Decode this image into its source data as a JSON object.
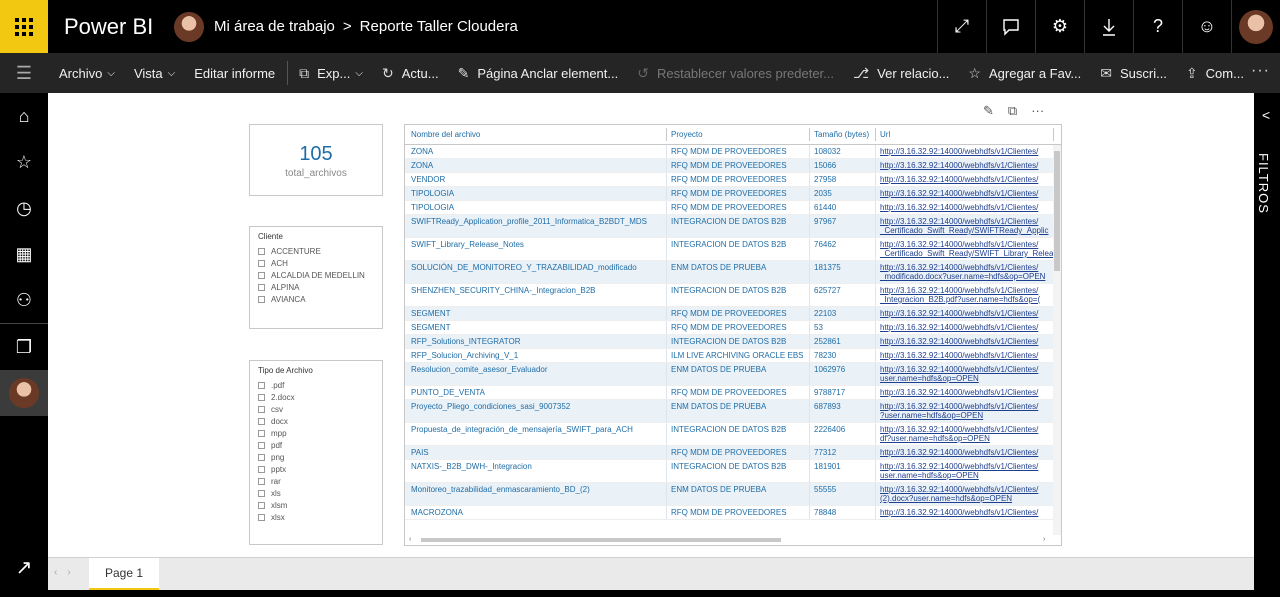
{
  "app": {
    "brand": "Power BI"
  },
  "breadcrumb": {
    "workspace": "Mi área de trabajo",
    "separator": ">",
    "report": "Reporte Taller Cloudera"
  },
  "top_icons": [
    "expand-icon",
    "comment-icon",
    "settings-icon",
    "download-icon",
    "help-icon",
    "smiley-icon"
  ],
  "toolbar": {
    "archivo": "Archivo",
    "vista": "Vista",
    "editar": "Editar informe",
    "exportar": "Exp...",
    "actualizar": "Actu...",
    "anclar": "Página Anclar element...",
    "restablecer": "Restablecer valores predeter...",
    "relaciones": "Ver relacio...",
    "favoritos": "Agregar a Fav...",
    "suscribir": "Suscri...",
    "compartir": "Com...",
    "more": "···"
  },
  "filter_pane": {
    "label": "FILTROS"
  },
  "card": {
    "value": "105",
    "label": "total_archivos"
  },
  "slicer_cliente": {
    "title": "Cliente",
    "items": [
      "ACCENTURE",
      "ACH",
      "ALCALDIA DE MEDELLIN",
      "ALPINA",
      "AVIANCA"
    ]
  },
  "slicer_tipo": {
    "title": "Tipo de Archivo",
    "items": [
      ".pdf",
      "2.docx",
      "csv",
      "docx",
      "mpp",
      "pdf",
      "png",
      "pptx",
      "rar",
      "xls",
      "xlsm",
      "xlsx"
    ]
  },
  "table": {
    "headers": [
      "Nombre del archivo",
      "Proyecto",
      "Tamaño (bytes)",
      "Url"
    ],
    "rows": [
      {
        "name": "ZONA",
        "project": "RFQ MDM DE PROVEEDORES",
        "size": "108032",
        "url1": "http://3.16.32.92:14000/webhdfs/v1/Clientes/",
        "url2": ""
      },
      {
        "name": "ZONA",
        "project": "RFQ MDM DE PROVEEDORES",
        "size": "15066",
        "url1": "http://3.16.32.92:14000/webhdfs/v1/Clientes/",
        "url2": ""
      },
      {
        "name": "VENDOR",
        "project": "RFQ MDM DE PROVEEDORES",
        "size": "27958",
        "url1": "http://3.16.32.92:14000/webhdfs/v1/Clientes/",
        "url2": ""
      },
      {
        "name": "TIPOLOGIA",
        "project": "RFQ MDM DE PROVEEDORES",
        "size": "2035",
        "url1": "http://3.16.32.92:14000/webhdfs/v1/Clientes/",
        "url2": ""
      },
      {
        "name": "TIPOLOGIA",
        "project": "RFQ MDM DE PROVEEDORES",
        "size": "61440",
        "url1": "http://3.16.32.92:14000/webhdfs/v1/Clientes/",
        "url2": ""
      },
      {
        "name": "SWIFTReady_Application_profile_2011_Informatica_B2BDT_MDS",
        "project": "INTEGRACION DE DATOS B2B",
        "size": "97967",
        "url1": "http://3.16.32.92:14000/webhdfs/v1/Clientes/",
        "url2": "_Certificado_Swift_Ready/SWIFTReady_Applic"
      },
      {
        "name": "SWIFT_Library_Release_Notes",
        "project": "INTEGRACION DE DATOS B2B",
        "size": "76462",
        "url1": "http://3.16.32.92:14000/webhdfs/v1/Clientes/",
        "url2": "_Certificado_Swift_Ready/SWIFT_Library_Relea"
      },
      {
        "name": "SOLUCIÓN_DE_MONITOREO_Y_TRAZABILIDAD_modificado",
        "project": "ENM DATOS DE PRUEBA",
        "size": "181375",
        "url1": "http://3.16.32.92:14000/webhdfs/v1/Clientes/",
        "url2": "_modificado.docx?user.name=hdfs&op=OPEN"
      },
      {
        "name": "SHENZHEN_SECURITY_CHINA-_Integracion_B2B",
        "project": "INTEGRACION DE DATOS B2B",
        "size": "625727",
        "url1": "http://3.16.32.92:14000/webhdfs/v1/Clientes/",
        "url2": "_Integracion_B2B.pdf?user.name=hdfs&op=("
      },
      {
        "name": "SEGMENT",
        "project": "RFQ MDM DE PROVEEDORES",
        "size": "22103",
        "url1": "http://3.16.32.92:14000/webhdfs/v1/Clientes/",
        "url2": ""
      },
      {
        "name": "SEGMENT",
        "project": "RFQ MDM DE PROVEEDORES",
        "size": "53",
        "url1": "http://3.16.32.92:14000/webhdfs/v1/Clientes/",
        "url2": ""
      },
      {
        "name": "RFP_Solutions_INTEGRATOR",
        "project": "INTEGRACION DE DATOS B2B",
        "size": "252861",
        "url1": "http://3.16.32.92:14000/webhdfs/v1/Clientes/",
        "url2": ""
      },
      {
        "name": "RFP_Solucion_Archiving_V_1",
        "project": "ILM LIVE ARCHIVING ORACLE EBS",
        "size": "78230",
        "url1": "http://3.16.32.92:14000/webhdfs/v1/Clientes/",
        "url2": ""
      },
      {
        "name": "Resolucion_comite_asesor_Evaluador",
        "project": "ENM DATOS DE PRUEBA",
        "size": "1062976",
        "url1": "http://3.16.32.92:14000/webhdfs/v1/Clientes/",
        "url2": "user.name=hdfs&op=OPEN"
      },
      {
        "name": "PUNTO_DE_VENTA",
        "project": "RFQ MDM DE PROVEEDORES",
        "size": "9788717",
        "url1": "http://3.16.32.92:14000/webhdfs/v1/Clientes/",
        "url2": ""
      },
      {
        "name": "Proyecto_Pliego_condiciones_sasi_9007352",
        "project": "ENM DATOS DE PRUEBA",
        "size": "687893",
        "url1": "http://3.16.32.92:14000/webhdfs/v1/Clientes/",
        "url2": "?user.name=hdfs&op=OPEN"
      },
      {
        "name": "Propuesta_de_integración_de_mensajería_SWIFT_para_ACH",
        "project": "INTEGRACION DE DATOS B2B",
        "size": "2226406",
        "url1": "http://3.16.32.92:14000/webhdfs/v1/Clientes/",
        "url2": "df?user.name=hdfs&op=OPEN"
      },
      {
        "name": "PAIS",
        "project": "RFQ MDM DE PROVEEDORES",
        "size": "77312",
        "url1": "http://3.16.32.92:14000/webhdfs/v1/Clientes/",
        "url2": ""
      },
      {
        "name": "NATXIS-_B2B_DWH-_Integracion",
        "project": "INTEGRACION DE DATOS B2B",
        "size": "181901",
        "url1": "http://3.16.32.92:14000/webhdfs/v1/Clientes/",
        "url2": "user.name=hdfs&op=OPEN"
      },
      {
        "name": "Monitoreo_trazabilidad_enmascaramiento_BD_(2)",
        "project": "ENM DATOS DE PRUEBA",
        "size": "55555",
        "url1": "http://3.16.32.92:14000/webhdfs/v1/Clientes/",
        "url2": "(2).docx?user.name=hdfs&op=OPEN"
      },
      {
        "name": "MACROZONA",
        "project": "RFQ MDM DE PROVEEDORES",
        "size": "78848",
        "url1": "http://3.16.32.92:14000/webhdfs/v1/Clientes/",
        "url2": ""
      }
    ]
  },
  "page_tab": {
    "label": "Page 1"
  },
  "colors": {
    "accent": "#f2c811",
    "link": "#1f6da6",
    "row_alt": "#eaf1f7"
  }
}
